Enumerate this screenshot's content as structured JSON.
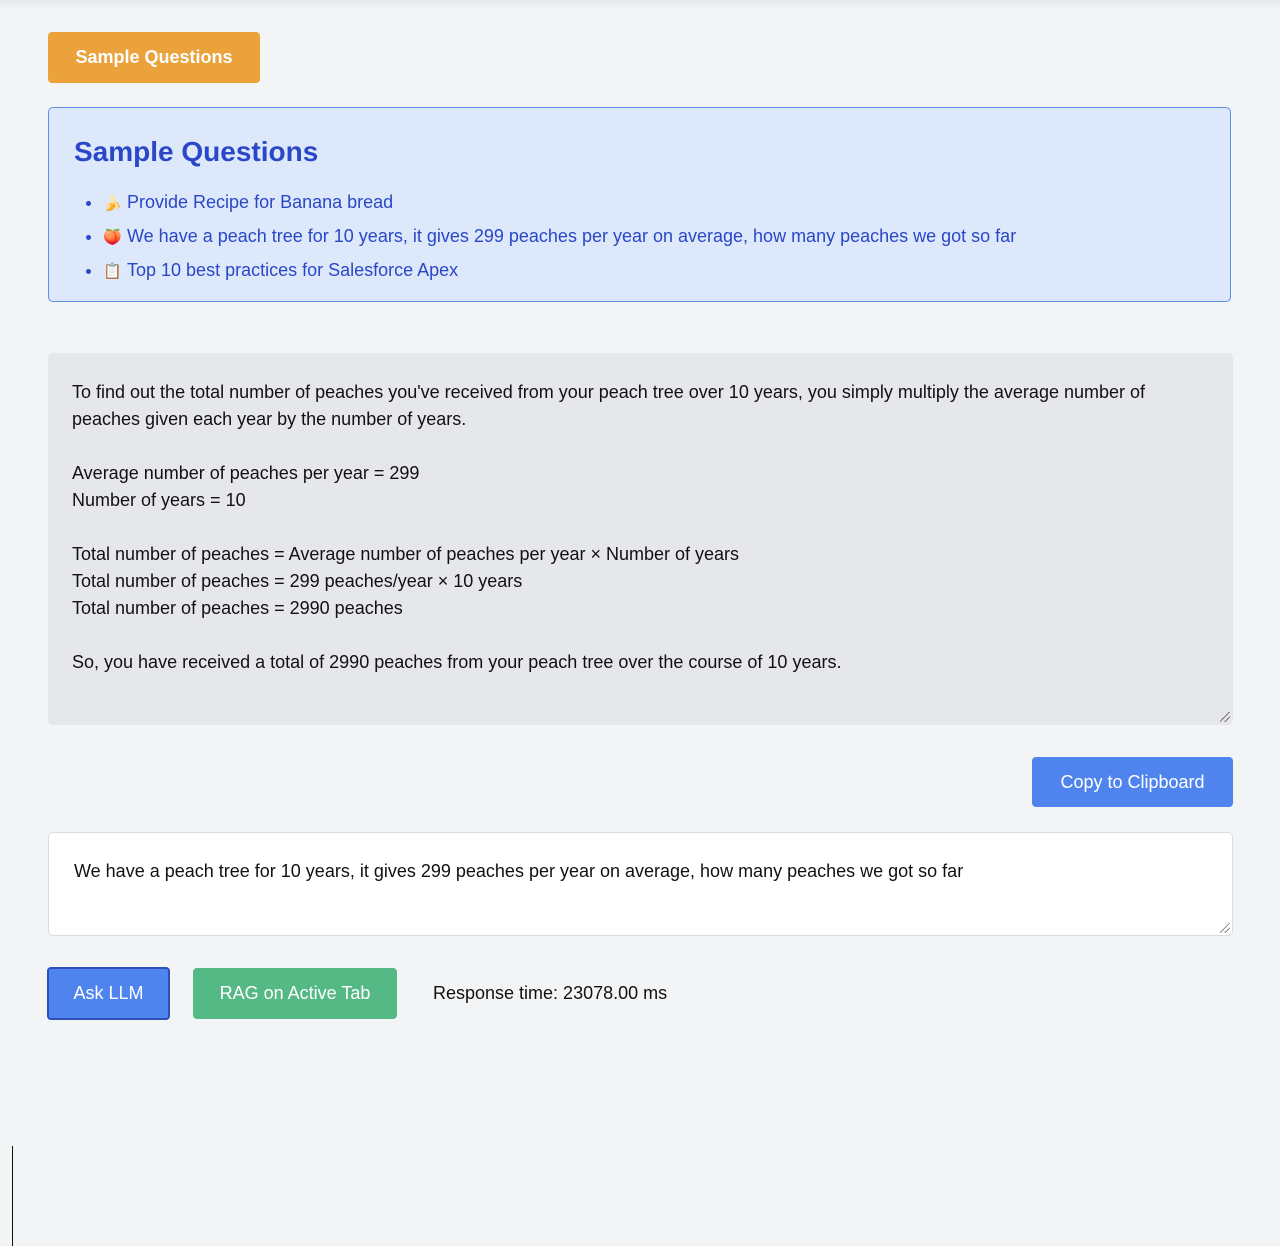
{
  "sample_button": {
    "label": "Sample Questions"
  },
  "sample_panel": {
    "title": "Sample Questions",
    "items": [
      {
        "emoji": "🍌",
        "text": "Provide Recipe for Banana bread"
      },
      {
        "emoji": "🍑",
        "text": "We have a peach tree for 10 years, it gives 299 peaches per year on average, how many peaches we got so far"
      },
      {
        "emoji": "📋",
        "text": "Top 10 best practices for Salesforce Apex"
      }
    ]
  },
  "answer": {
    "text": "To find out the total number of peaches you've received from your peach tree over 10 years, you simply multiply the average number of peaches given each year by the number of years.\n\nAverage number of peaches per year = 299\nNumber of years = 10\n\nTotal number of peaches = Average number of peaches per year × Number of years\nTotal number of peaches = 299 peaches/year × 10 years\nTotal number of peaches = 2990 peaches\n\nSo, you have received a total of 2990 peaches from your peach tree over the course of 10 years."
  },
  "copy_button": {
    "label": "Copy to Clipboard"
  },
  "question_input": {
    "value": "We have a peach tree for 10 years, it gives 299 peaches per year on average, how many peaches we got so far"
  },
  "actions": {
    "ask_label": "Ask LLM",
    "rag_label": "RAG on Active Tab",
    "response_time": "Response time: 23078.00 ms"
  },
  "colors": {
    "sample_button": "#eba23a",
    "panel_bg": "#dde8fa",
    "panel_border": "#5d8fe6",
    "panel_text": "#2a47c8",
    "primary_button": "#4f84ee",
    "rag_button": "#55b985",
    "answer_bg": "#e5e7eb"
  }
}
